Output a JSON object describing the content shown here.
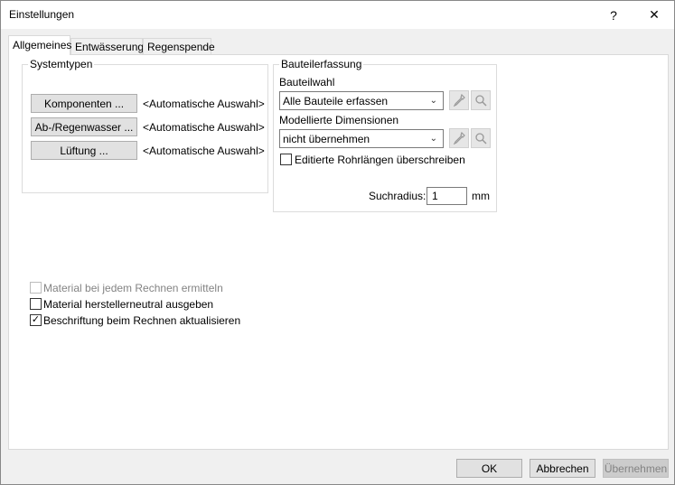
{
  "window": {
    "title": "Einstellungen",
    "help": "?",
    "close": "✕"
  },
  "tabs": [
    {
      "label": "Allgemeines"
    },
    {
      "label": "Entwässerung"
    },
    {
      "label": "Regenspende"
    }
  ],
  "systemtypen": {
    "legend": "Systemtypen",
    "rows": [
      {
        "button": "Komponenten ...",
        "value": "<Automatische Auswahl>"
      },
      {
        "button": "Ab-/Regenwasser ...",
        "value": "<Automatische Auswahl>"
      },
      {
        "button": "Lüftung ...",
        "value": "<Automatische Auswahl>"
      }
    ]
  },
  "bauteilerfassung": {
    "legend": "Bauteilerfassung",
    "bauteilwahl_label": "Bauteilwahl",
    "bauteilwahl_value": "Alle Bauteile erfassen",
    "dimensionen_label": "Modellierte Dimensionen",
    "dimensionen_value": "nicht übernehmen",
    "rohrlaengen_label": "Editierte Rohrlängen überschreiben",
    "rohrlaengen_checked": false,
    "suchradius_label": "Suchradius:",
    "suchradius_value": "1",
    "suchradius_unit": "mm"
  },
  "options": [
    {
      "label": "Material bei jedem Rechnen ermitteln",
      "checked": false,
      "disabled": true
    },
    {
      "label": "Material herstellerneutral ausgeben",
      "checked": false,
      "disabled": false
    },
    {
      "label": "Beschriftung beim Rechnen aktualisieren",
      "checked": true,
      "disabled": false
    }
  ],
  "footer": {
    "ok": "OK",
    "cancel": "Abbrechen",
    "apply": "Übernehmen"
  }
}
